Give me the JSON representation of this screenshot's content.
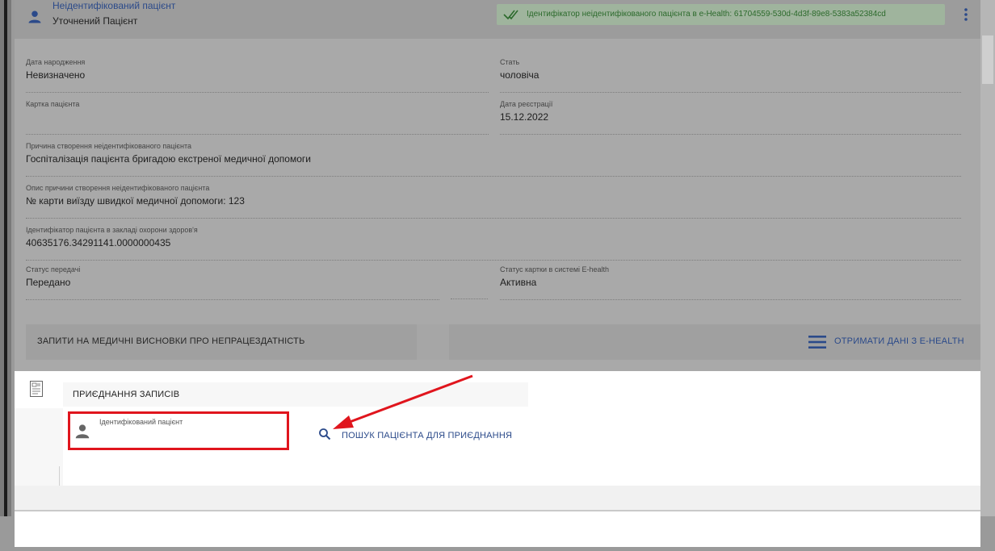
{
  "patient": {
    "title": "Неідентифікований пацієнт",
    "subtitle": "Уточнений Пацієнт",
    "ehealth_id_text": "Ідентифікатор неідентифікованого пацієнта в e-Health: 61704559-530d-4d3f-89e8-5383a52384cd"
  },
  "fields": {
    "birth_date": {
      "label": "Дата народження",
      "value": "Невизначено"
    },
    "sex": {
      "label": "Стать",
      "value": "чоловіча"
    },
    "card": {
      "label": "Картка пацієнта",
      "value": ""
    },
    "reg_date": {
      "label": "Дата реєстрації",
      "value": "15.12.2022"
    },
    "reason": {
      "label": "Причина створення неідентифікованого пацієнта",
      "value": "Госпіталізація пацієнта бригадою екстреної медичної допомоги"
    },
    "reason_desc": {
      "label": "Опис причини створення неідентифікованого пацієнта",
      "value": "№ карти виїзду швидкої медичної допомоги: 123"
    },
    "facility_id": {
      "label": "Ідентифікатор пацієнта в закладі охорони здоров'я",
      "value": "40635176.34291141.0000000435"
    },
    "transfer_status": {
      "label": "Статус передачі",
      "value": "Передано"
    },
    "card_status": {
      "label": "Статус картки в системі E-health",
      "value": "Активна"
    }
  },
  "sick_leave": {
    "title": "ЗАПИТИ НА МЕДИЧНІ ВИСНОВКИ ПРО НЕПРАЦЕЗДАТНІСТЬ",
    "action": "ОТРИМАТИ ДАНІ З E-HEALTH"
  },
  "merge": {
    "title": "ПРИЄДНАННЯ ЗАПИСІВ",
    "patient_label": "Ідентифікований пацієнт",
    "search_label": "ПОШУК ПАЦІЄНТА ДЛЯ ПРИЄДНАННЯ"
  },
  "icons": {
    "avatar": "person-icon",
    "check": "double-check-icon",
    "kebab": "more-vert-icon",
    "menu": "menu-icon",
    "doc": "document-icon",
    "search": "search-icon"
  },
  "colors": {
    "accent": "#2b4a8a",
    "success": "#2c6a2c",
    "highlight": "#e0151d"
  }
}
